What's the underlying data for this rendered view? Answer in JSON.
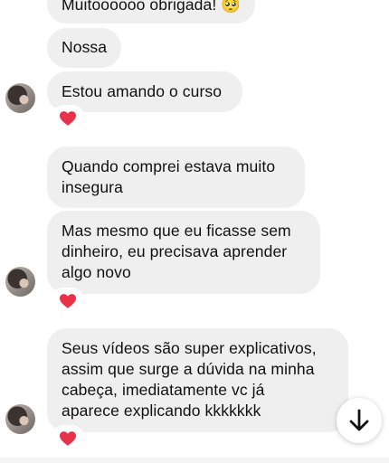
{
  "messages": [
    {
      "text": "Muitoooooo obrigada! 🥺"
    },
    {
      "text": "Nossa"
    },
    {
      "text": "Estou amando o curso"
    },
    {
      "text": "Quando comprei estava muito\ninsegura"
    },
    {
      "text": "Mas mesmo que eu ficasse sem\ndinheiro, eu precisava aprender\nalgo novo"
    },
    {
      "text": "Seus vídeos são super explicativos,\nassim que surge a dúvida na minha\ncabeça, imediatamente vc já\naparece explicando kkkkkkk"
    }
  ],
  "reactions": [
    {
      "icon": "heart-icon",
      "color": "#e8324a"
    },
    {
      "icon": "heart-icon",
      "color": "#e8324a"
    },
    {
      "icon": "heart-icon",
      "color": "#e8324a"
    }
  ],
  "scroll_button": {
    "icon": "arrow-down-icon"
  },
  "colors": {
    "bubble": "#efefef",
    "background": "#ffffff",
    "heart": "#e8324a"
  }
}
